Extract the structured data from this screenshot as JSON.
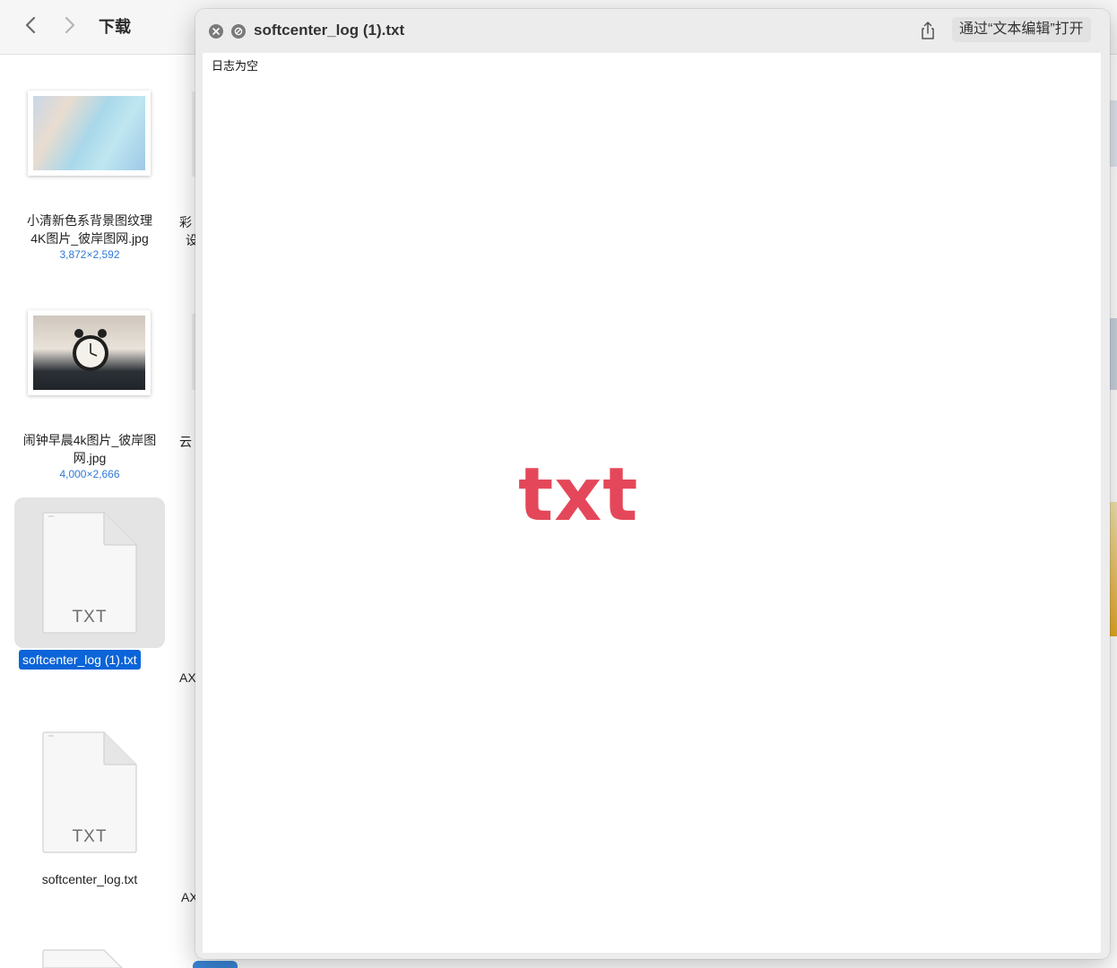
{
  "finder": {
    "title": "下载",
    "items": [
      {
        "name_line1": "小清新色系背景图纹理",
        "name_line2": "4K图片_彼岸图网.jpg",
        "meta": "3,872×2,592"
      },
      {
        "name_line1": "闹钟早晨4k图片_彼岸图",
        "name_line2": "网.jpg",
        "meta": "4,000×2,666"
      },
      {
        "name": "softcenter_log (1).txt",
        "icon_label": "TXT"
      },
      {
        "name": "softcenter_log.txt",
        "icon_label": "TXT"
      }
    ],
    "peek_texts": [
      "彩",
      "设",
      "云",
      "AX",
      "AX"
    ]
  },
  "quicklook": {
    "title": "softcenter_log (1).txt",
    "open_with": "通过“文本编辑”打开",
    "content_text": "日志为空",
    "file_type_badge": "txt",
    "icons": {
      "close": "close-icon",
      "fullscreen": "no-entry-icon",
      "share": "share-icon"
    }
  },
  "colors": {
    "accent": "#0b64d8",
    "badge": "#e5475a"
  }
}
